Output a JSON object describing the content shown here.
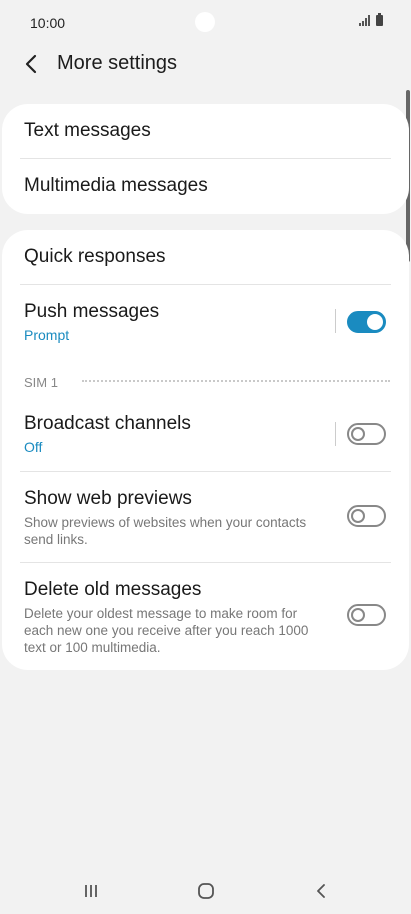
{
  "status_bar": {
    "time": "10:00"
  },
  "header": {
    "title": "More settings"
  },
  "card1": {
    "items": [
      {
        "title": "Text messages"
      },
      {
        "title": "Multimedia messages"
      }
    ]
  },
  "card2": {
    "quick_responses": {
      "title": "Quick responses"
    },
    "push_messages": {
      "title": "Push messages",
      "subtitle": "Prompt",
      "toggle": "on"
    },
    "sim_label": "SIM 1",
    "broadcast": {
      "title": "Broadcast channels",
      "subtitle": "Off",
      "toggle": "off"
    },
    "web_previews": {
      "title": "Show web previews",
      "description": "Show previews of websites when your contacts send links.",
      "toggle": "off"
    },
    "delete_old": {
      "title": "Delete old messages",
      "description": "Delete your oldest message to make room for each new one you receive after you reach 1000 text or 100 multimedia.",
      "toggle": "off"
    }
  },
  "colors": {
    "accent": "#1a8bc0",
    "background": "#f2f2f2",
    "card": "#ffffff"
  }
}
